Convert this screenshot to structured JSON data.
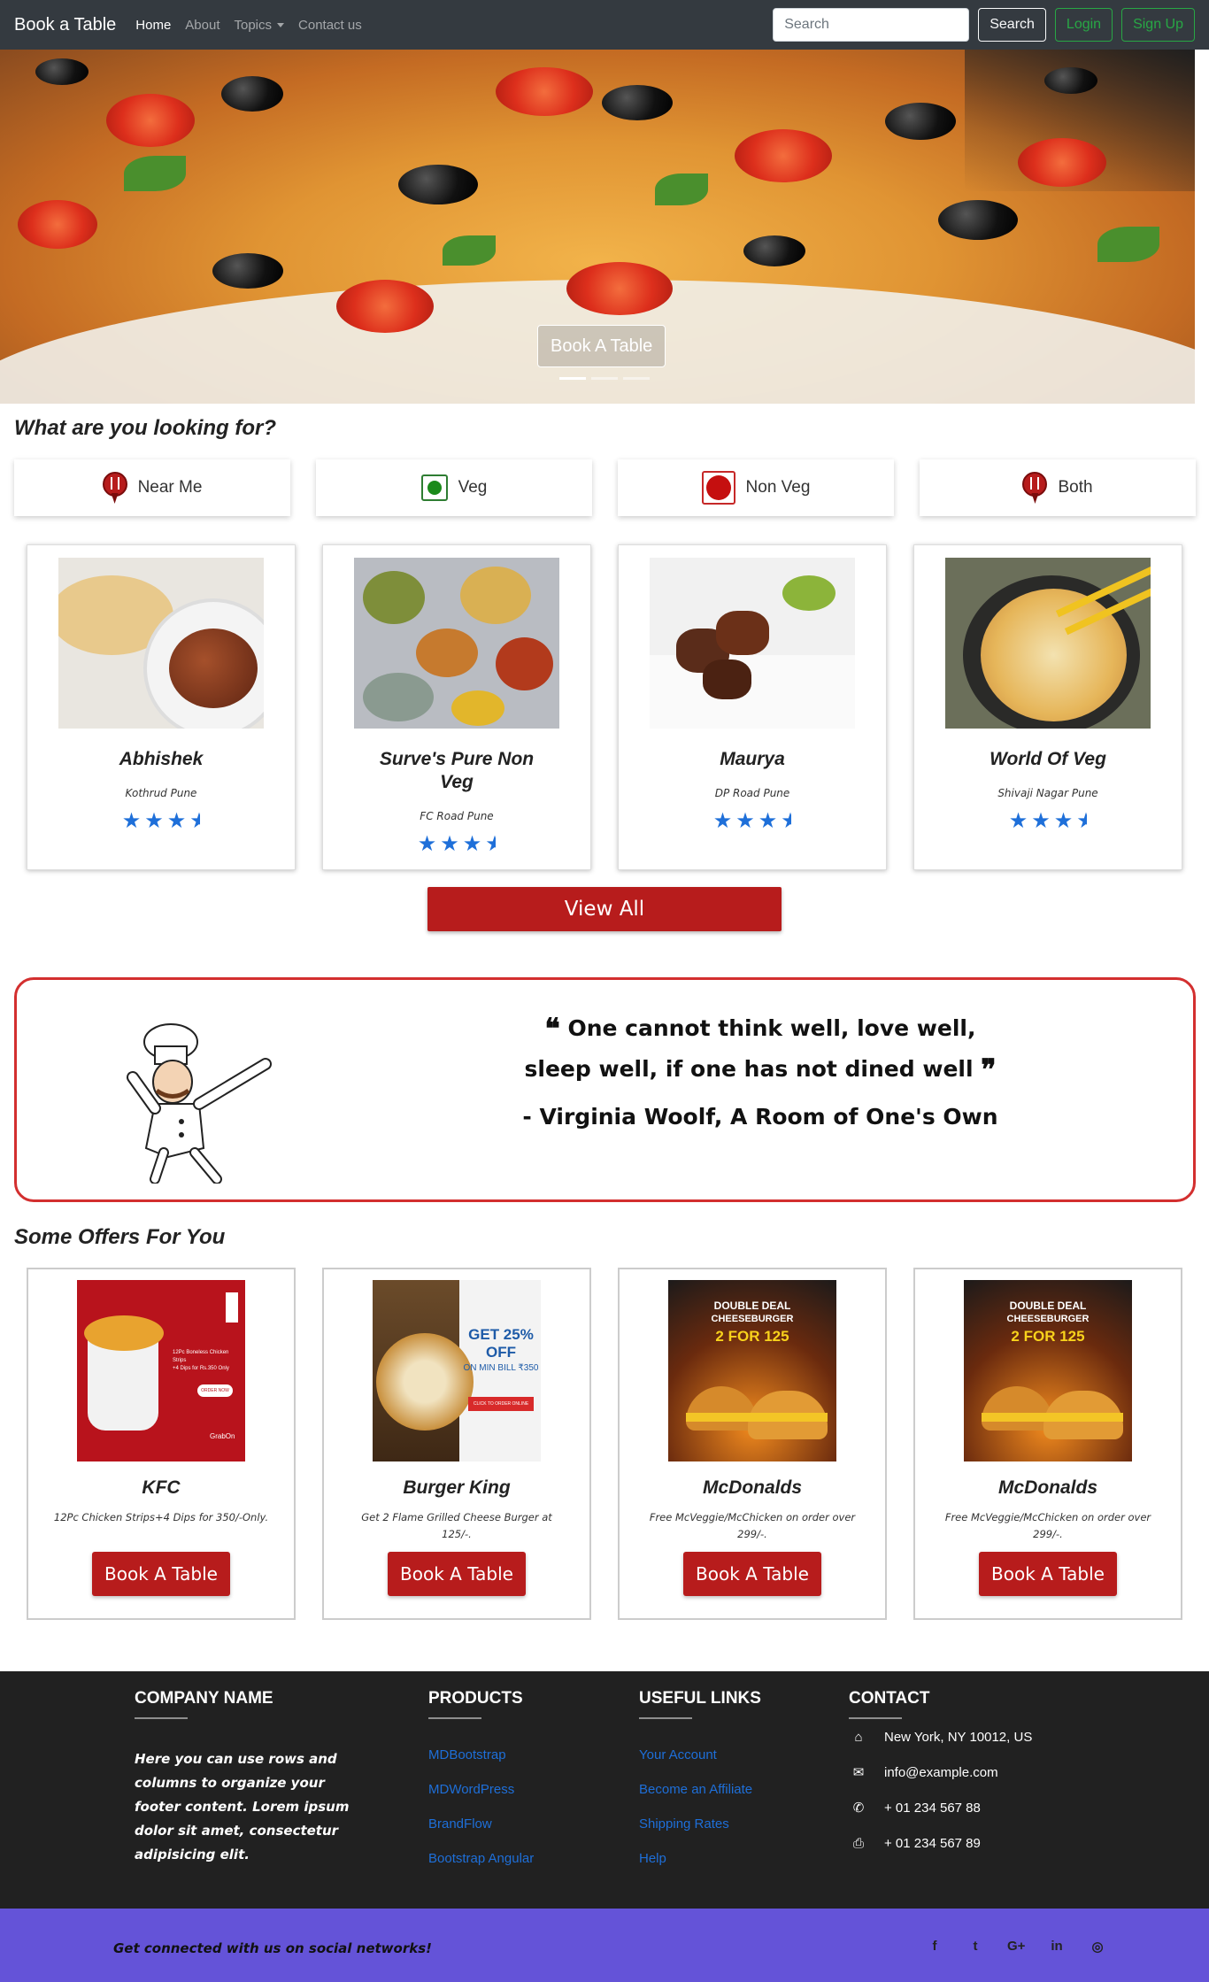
{
  "nav": {
    "brand": "Book a Table",
    "links": [
      "Home",
      "About",
      "Topics",
      "Contact us"
    ],
    "search_placeholder": "Search",
    "search_button": "Search",
    "login": "Login",
    "signup": "Sign Up"
  },
  "hero": {
    "button": "Book A Table",
    "slides": 3,
    "active_slide": 1
  },
  "looking_for": {
    "title": "What are you looking for?",
    "filters": [
      {
        "label": "Near Me",
        "icon": "map-pin-fork-icon"
      },
      {
        "label": "Veg",
        "icon": "veg-symbol-icon"
      },
      {
        "label": "Non Veg",
        "icon": "non-veg-symbol-icon"
      },
      {
        "label": "Both",
        "icon": "map-pin-fork-icon"
      }
    ]
  },
  "restaurants": [
    {
      "name": "Abhishek",
      "location": "Kothrud Pune",
      "rating": 3.5
    },
    {
      "name": "Surve's Pure Non Veg",
      "location": "FC Road Pune",
      "rating": 3.5
    },
    {
      "name": "Maurya",
      "location": "DP Road Pune",
      "rating": 3.5
    },
    {
      "name": "World Of Veg",
      "location": "Shivaji Nagar Pune",
      "rating": 3.5
    }
  ],
  "view_all": "View All",
  "quote": {
    "text": "One cannot think well, love well, sleep well, if one has not dined well",
    "author": "- Virginia Woolf, A Room of One's Own"
  },
  "offers": {
    "title": "Some Offers For You",
    "items": [
      {
        "name": "KFC",
        "desc": "12Pc Chicken Strips+4 Dips for 350/-Only.",
        "button": "Book A Table",
        "img_text": [
          "12Pc Boneless Chicken Strips",
          "+4 Dips for Rs.350 Only",
          "ORDER NOW",
          "GrabOn"
        ]
      },
      {
        "name": "Burger King",
        "desc": "Get 2 Flame Grilled Cheese Burger at 125/-.",
        "button": "Book A Table",
        "img_text": [
          "GET 25% OFF",
          "ON MIN BILL ₹350",
          "CLICK TO ORDER ONLINE"
        ]
      },
      {
        "name": "McDonalds",
        "desc": "Free McVeggie/McChicken on order over 299/-.",
        "button": "Book A Table",
        "img_text": [
          "DOUBLE DEAL",
          "CHEESEBURGER",
          "2 FOR 125"
        ]
      },
      {
        "name": "McDonalds",
        "desc": "Free McVeggie/McChicken on order over 299/-.",
        "button": "Book A Table",
        "img_text": [
          "DOUBLE DEAL",
          "CHEESEBURGER",
          "2 FOR 125"
        ]
      }
    ]
  },
  "footer": {
    "company": {
      "heading": "Company name",
      "text": "Here you can use rows and columns to organize your footer content. Lorem ipsum dolor sit amet, consectetur adipisicing elit."
    },
    "products": {
      "heading": "Products",
      "links": [
        "MDBootstrap",
        "MDWordPress",
        "BrandFlow",
        "Bootstrap Angular"
      ]
    },
    "useful": {
      "heading": "Useful links",
      "links": [
        "Your Account",
        "Become an Affiliate",
        "Shipping Rates",
        "Help"
      ]
    },
    "contact": {
      "heading": "Contact",
      "rows": [
        {
          "icon": "home-icon",
          "text": "New York, NY 10012, US"
        },
        {
          "icon": "envelope-icon",
          "text": "info@example.com"
        },
        {
          "icon": "phone-icon",
          "text": "+ 01 234 567 88"
        },
        {
          "icon": "print-icon",
          "text": "+ 01 234 567 89"
        }
      ]
    }
  },
  "social": {
    "text": "Get connected with us on social networks!",
    "icons": [
      "facebook-icon",
      "twitter-icon",
      "google-plus-icon",
      "linkedin-icon",
      "instagram-icon"
    ],
    "glyphs": [
      "f",
      "t",
      "G+",
      "in",
      "◎"
    ]
  },
  "colors": {
    "navbar": "#343a40",
    "accent_red": "#b71c1c",
    "footer": "#212121",
    "social_bar": "#6453d8",
    "link_blue": "#1e6fd9",
    "star_blue": "#1e6fd9"
  }
}
